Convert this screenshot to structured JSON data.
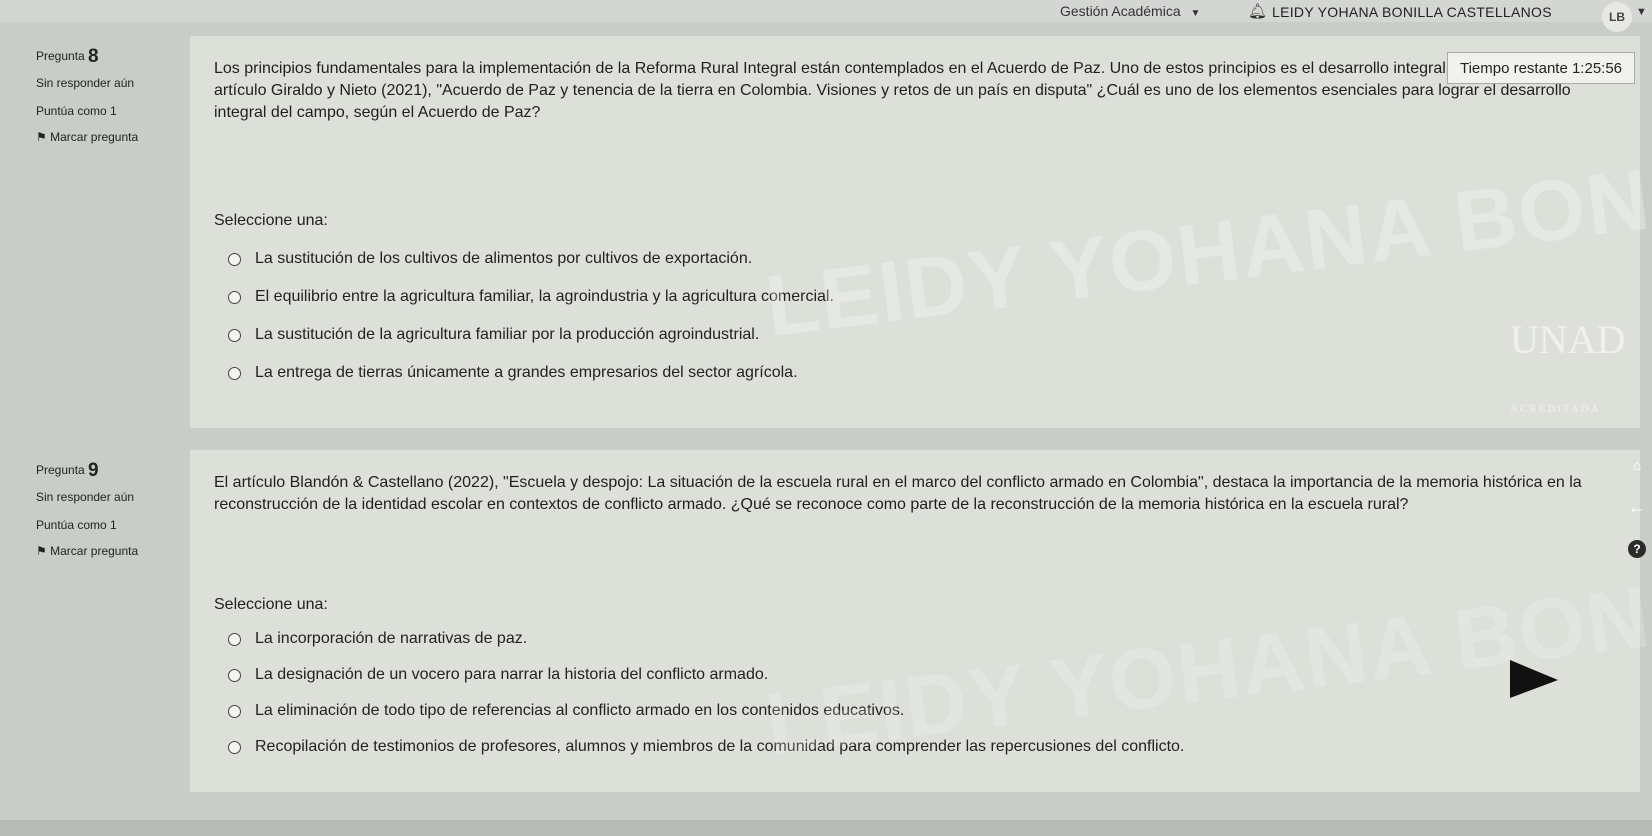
{
  "topbar": {
    "menu_label": "Gestión Académica",
    "user_name": "LEIDY YOHANA BONILLA CASTELLANOS",
    "avatar_initials": "LB"
  },
  "timer": {
    "text": "Tiempo restante 1:25:56"
  },
  "questions": [
    {
      "label": "Pregunta",
      "number": "8",
      "status": "Sin responder aún",
      "score": "Puntúa como 1",
      "flag": "Marcar pregunta",
      "text": "Los principios fundamentales para la implementación de la Reforma Rural Integral están contemplados en el Acuerdo de Paz. Uno de estos principios es el desarrollo integral del campo. En el artículo Giraldo y Nieto (2021), \"Acuerdo de Paz y tenencia de la tierra en Colombia. Visiones y retos de un país en disputa\" ¿Cuál es uno de los elementos esenciales para lograr el desarrollo integral del campo, según el Acuerdo de Paz?",
      "select_label": "Seleccione una:",
      "options": [
        "La sustitución de los cultivos de alimentos por cultivos de exportación.",
        "El equilibrio entre la agricultura familiar, la agroindustria y la agricultura comercial.",
        "La sustitución de la agricultura familiar por la producción agroindustrial.",
        "La entrega de tierras únicamente a grandes empresarios del sector agrícola."
      ]
    },
    {
      "label": "Pregunta",
      "number": "9",
      "status": "Sin responder aún",
      "score": "Puntúa como 1",
      "flag": "Marcar pregunta",
      "text": "El artículo Blandón & Castellano (2022), \"Escuela y despojo: La situación de la escuela rural en el marco del conflicto armado en Colombia\", destaca la importancia de la memoria histórica en la reconstrucción de la identidad escolar en contextos de conflicto armado. ¿Qué se reconoce como parte de la reconstrucción de la memoria histórica en la escuela rural?",
      "select_label": "Seleccione una:",
      "options": [
        "La incorporación de narrativas de paz.",
        "La designación de un vocero para narrar la historia del conflicto armado.",
        "La eliminación de todo tipo de referencias al conflicto armado en los contenidos educativos.",
        "Recopilación de testimonios de profesores, alumnos y miembros de la comunidad para comprender las repercusiones del conflicto."
      ]
    }
  ],
  "watermark": {
    "line1": "LEIDY YOHANA BONILLA CASTELLANOS",
    "logo_text": "UNAD",
    "logo_sub": "ACREDITADA"
  },
  "icons": {
    "menu_chevron": "chevron-down-icon",
    "notification": "bell-icon",
    "flag": "flag-icon",
    "radio": "radio-button-icon",
    "home": "home-icon",
    "back": "arrow-left-icon",
    "help": "help-icon",
    "cursor": "pointer-arrow-icon"
  }
}
